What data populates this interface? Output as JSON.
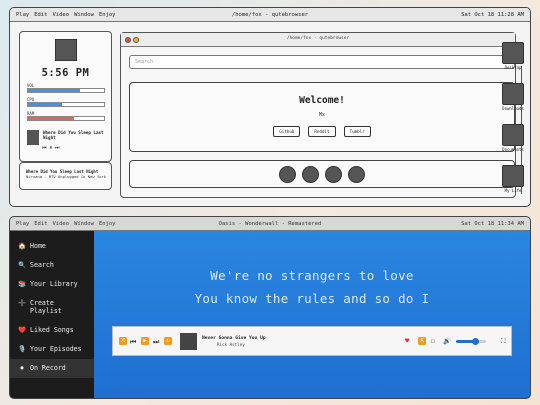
{
  "top_window": {
    "menu": [
      "Play",
      "Edit",
      "Video",
      "Window",
      "Enjoy"
    ],
    "title": "/home/fox - qutebrowser",
    "clock": "Sat Oct 18 11:28 AM"
  },
  "widget": {
    "time": "5:56 PM",
    "stats": [
      {
        "label": "VOL",
        "value": 0.68,
        "color": "#4a90e2"
      },
      {
        "label": "CPU",
        "value": 0.45,
        "color": "#4a90e2"
      },
      {
        "label": "RAM",
        "value": 0.6,
        "color": "#e06666"
      }
    ],
    "song_title": "Where Did You Sleep Last Night",
    "controls": [
      "⏮",
      "⏸",
      "⏭"
    ]
  },
  "now_playing_card": {
    "title": "Where Did You Sleep Last Night",
    "subtitle": "Nirvana - MTV Unplugged In New York"
  },
  "browser": {
    "title": "/home/fox - qutebrowser",
    "search_placeholder": "Search",
    "welcome_heading": "Welcome!",
    "username": "Mx",
    "links": [
      "Github",
      "Reddit",
      "Tumblr"
    ]
  },
  "dock": [
    "Desktop",
    "Downloads",
    "Documents",
    "My Life"
  ],
  "bottom_window": {
    "menu": [
      "Play",
      "Edit",
      "Video",
      "Window",
      "Enjoy"
    ],
    "title": "Oasis - Wonderwall - Remastered",
    "clock": "Sat Oct 18 11:34 AM"
  },
  "sidebar": [
    {
      "icon": "🏠",
      "label": "Home"
    },
    {
      "icon": "🔍",
      "label": "Search"
    },
    {
      "icon": "📚",
      "label": "Your Library"
    },
    {
      "icon": "➕",
      "label": "Create Playlist"
    },
    {
      "icon": "❤️",
      "label": "Liked Songs"
    },
    {
      "icon": "🎙️",
      "label": "Your Episodes"
    },
    {
      "icon": "⏺",
      "label": "On Record"
    }
  ],
  "lyrics": [
    "We're no strangers to love",
    "You know the rules and so do I"
  ],
  "player": {
    "song": "Never Gonna Give You Up",
    "artist": "Rick Astley",
    "volume": 0.65
  }
}
